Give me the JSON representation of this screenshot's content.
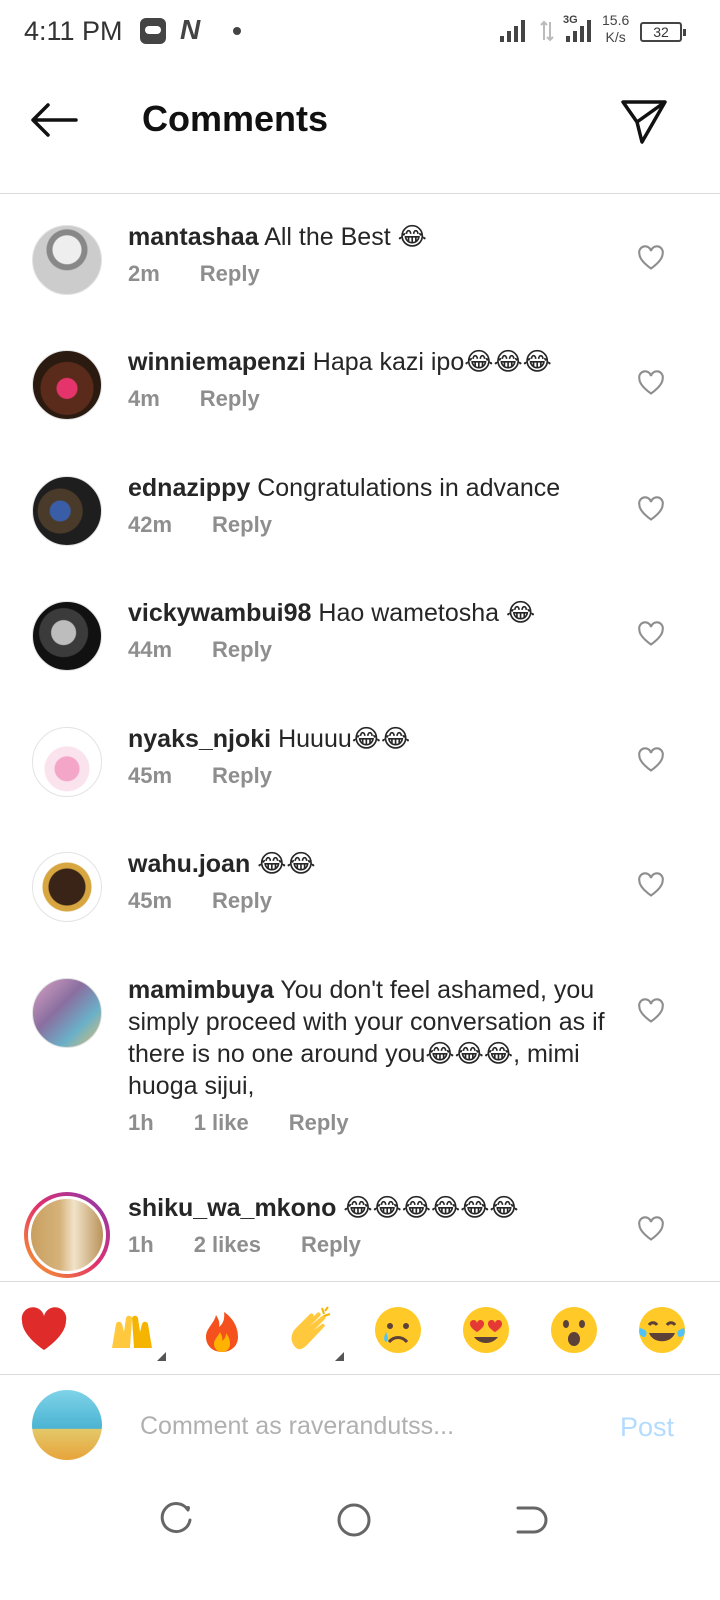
{
  "status_bar": {
    "time": "4:11 PM",
    "network_type": "3G",
    "speed_value": "15.6",
    "speed_unit": "K/s",
    "battery": "32"
  },
  "header": {
    "title": "Comments",
    "icons": {
      "back": "arrow-left-icon",
      "share": "paper-plane-icon"
    }
  },
  "comments": [
    {
      "username": "mantashaa",
      "text": "All the Best 😂",
      "time": "2m",
      "likes": "",
      "reply": "Reply"
    },
    {
      "username": "winniemapenzi",
      "text": "Hapa kazi ipo😂😂😂",
      "time": "4m",
      "likes": "",
      "reply": "Reply"
    },
    {
      "username": "ednazippy",
      "text": "Congratulations in advance",
      "time": "42m",
      "likes": "",
      "reply": "Reply"
    },
    {
      "username": "vickywambui98",
      "text": "Hao wametosha 😂",
      "time": "44m",
      "likes": "",
      "reply": "Reply"
    },
    {
      "username": "nyaks_njoki",
      "text": "Huuuu😂😂",
      "time": "45m",
      "likes": "",
      "reply": "Reply"
    },
    {
      "username": "wahu.joan",
      "text": "😂😂",
      "time": "45m",
      "likes": "",
      "reply": "Reply"
    },
    {
      "username": "mamimbuya",
      "text": "You don't feel ashamed, you simply proceed with your conversation as if there is no one around you😂😂😂, mimi huoga sijui,",
      "time": "1h",
      "likes": "1 like",
      "reply": "Reply"
    },
    {
      "username": "shiku_wa_mkono",
      "text": "😂😂😂😂😂😂",
      "time": "1h",
      "likes": "2 likes",
      "reply": "Reply"
    }
  ],
  "emoji_bar": [
    "❤️",
    "🙌",
    "🔥",
    "👏",
    "😢",
    "😍",
    "😮",
    "😂"
  ],
  "composer": {
    "placeholder": "Comment as raverandutss...",
    "post_label": "Post"
  },
  "colors": {
    "text": "#262626",
    "meta": "#8e8e8e",
    "post_disabled": "#b3dbff",
    "divider": "#dbdbdb"
  }
}
